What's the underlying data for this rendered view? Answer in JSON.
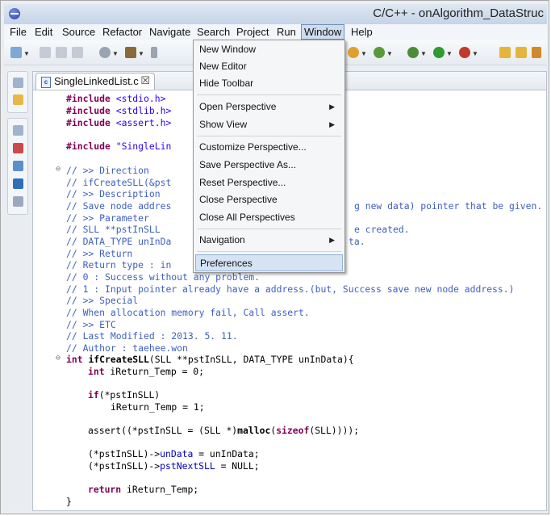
{
  "window": {
    "title": "C/C++ - onAlgorithm_DataStruc"
  },
  "menubar": {
    "items": [
      "File",
      "Edit",
      "Source",
      "Refactor",
      "Navigate",
      "Search",
      "Project",
      "Run",
      "Window",
      "Help"
    ],
    "active": "Window"
  },
  "editor": {
    "tab_label": "SingleLinkedList.c",
    "tab_close": "☒"
  },
  "code": {
    "inc1_kw": "#include",
    "inc1_rest": " <stdio.h>",
    "inc2_kw": "#include",
    "inc2_rest": " <stdlib.h>",
    "inc3_kw": "#include",
    "inc3_rest": " <assert.h>",
    "inc4_kw": "#include",
    "inc4_str": " \"SingleLin",
    "c1": "// >> Direction",
    "c2": "// ifCreateSLL(&pst",
    "c3": "// >> Description",
    "c4a": "// Save node addres",
    "c4b": "g new data) pointer that be given.",
    "c5": "// >> Parameter",
    "c6a": "// SLL **pstInSLL",
    "c6b": "e created.",
    "c7a": "// DATA_TYPE unInDa",
    "c7b": "ta.",
    "c8": "// >> Return",
    "c9": "// Return type : in",
    "c10": "// 0 : Success without any problem.",
    "c11": "// 1 : Input pointer already have a address.(but, Success save new node address.)",
    "c12": "// >> Special",
    "c13": "// When allocation memory fail, Call assert.",
    "c14": "// >> ETC",
    "c15": "// Last Modified : 2013. 5. 11.",
    "c16": "// Author : taehee.won",
    "sig_kw": "int ",
    "sig_name": "ifCreateSLL",
    "sig_rest": "(SLL **pstInSLL, DATA_TYPE unInData){",
    "l1_kw": "int",
    "l1_rest": " iReturn_Temp = 0;",
    "l2_kw": "if",
    "l2_rest": "(*pstInSLL)",
    "l3": "iReturn_Temp = 1;",
    "l4a": "assert((*pstInSLL = (SLL *)",
    "l4b": "malloc",
    "l4c": "(",
    "l4d": "sizeof",
    "l4e": "(SLL))));",
    "l5a": "(*pstInSLL)->",
    "l5b": "unData",
    "l5c": " = unInData;",
    "l6a": "(*pstInSLL)->",
    "l6b": "pstNextSLL",
    "l6c": " = NULL;",
    "l7_kw": "return",
    "l7_rest": " iReturn_Temp;",
    "close": "}"
  },
  "window_menu": {
    "new_window": "New Window",
    "new_editor": "New Editor",
    "hide_toolbar": "Hide Toolbar",
    "open_perspective": "Open Perspective",
    "show_view": "Show View",
    "customize_perspective": "Customize Perspective...",
    "save_perspective": "Save Perspective As...",
    "reset_perspective": "Reset Perspective...",
    "close_perspective": "Close Perspective",
    "close_all_perspectives": "Close All Perspectives",
    "navigation": "Navigation",
    "preferences": "Preferences",
    "submenu_arrow": "▶"
  }
}
